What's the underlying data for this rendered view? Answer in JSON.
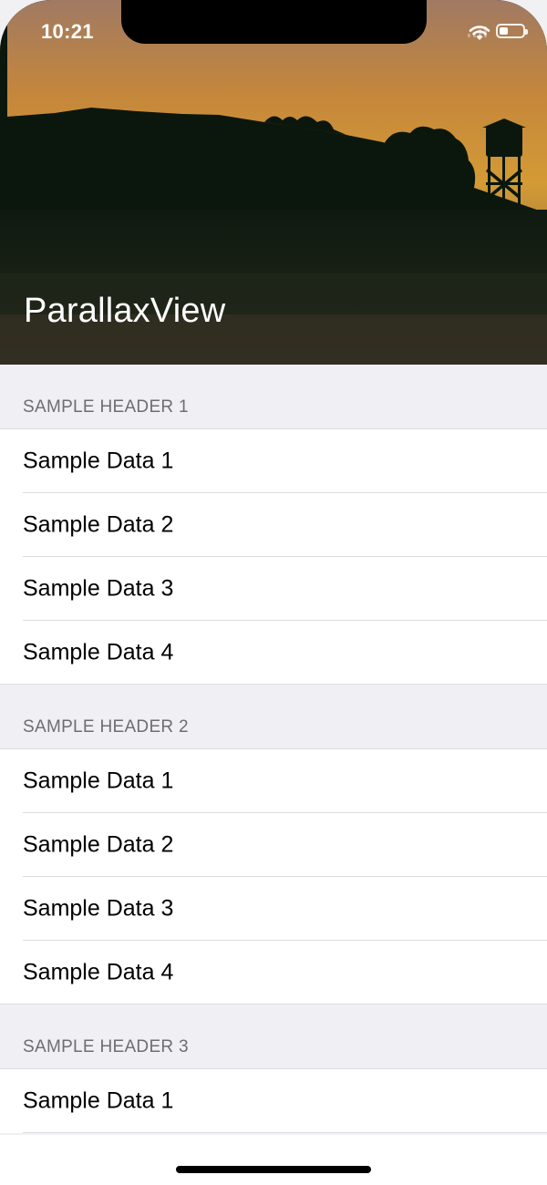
{
  "status_bar": {
    "time": "10:21"
  },
  "hero": {
    "title": "ParallaxView",
    "image_description_icon": "silhouette-sunset-image"
  },
  "sections": [
    {
      "header": "SAMPLE HEADER 1",
      "rows": [
        "Sample Data 1",
        "Sample Data 2",
        "Sample Data 3",
        "Sample Data 4"
      ]
    },
    {
      "header": "SAMPLE HEADER 2",
      "rows": [
        "Sample Data 1",
        "Sample Data 2",
        "Sample Data 3",
        "Sample Data 4"
      ]
    },
    {
      "header": "SAMPLE HEADER 3",
      "rows": [
        "Sample Data 1"
      ]
    }
  ],
  "colors": {
    "section_header_bg": "#efeff4",
    "section_header_text": "#6d6d72",
    "row_bg": "#ffffff",
    "separator": "#dcdce1"
  }
}
